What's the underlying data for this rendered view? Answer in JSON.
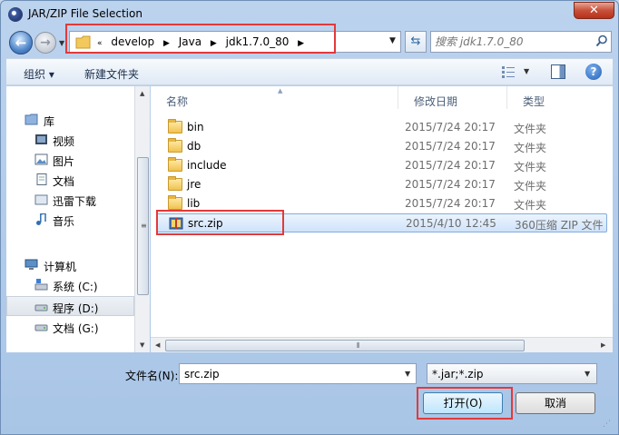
{
  "window": {
    "title": "JAR/ZIP File Selection",
    "close_label": "✕"
  },
  "address": {
    "crumbs": [
      "develop",
      "Java",
      "jdk1.7.0_80"
    ],
    "overflow": "«",
    "search_placeholder": "搜索 jdk1.7.0_80"
  },
  "toolbar": {
    "organize": "组织 ▾",
    "new_folder": "新建文件夹",
    "help": "?"
  },
  "nav": {
    "favorites": "库",
    "items": [
      "视频",
      "图片",
      "文档",
      "迅雷下载",
      "音乐"
    ],
    "computer": "计算机",
    "drives": [
      "系统 (C:)",
      "程序 (D:)",
      "文档 (G:)"
    ]
  },
  "columns": {
    "name": "名称",
    "modified": "修改日期",
    "type": "类型"
  },
  "files": [
    {
      "name": "bin",
      "modified": "2015/7/24 20:17",
      "type": "文件夹",
      "icon": "folder-icon"
    },
    {
      "name": "db",
      "modified": "2015/7/24 20:17",
      "type": "文件夹",
      "icon": "folder-icon"
    },
    {
      "name": "include",
      "modified": "2015/7/24 20:17",
      "type": "文件夹",
      "icon": "folder-icon"
    },
    {
      "name": "jre",
      "modified": "2015/7/24 20:17",
      "type": "文件夹",
      "icon": "folder-icon"
    },
    {
      "name": "lib",
      "modified": "2015/7/24 20:17",
      "type": "文件夹",
      "icon": "folder-icon"
    },
    {
      "name": "src.zip",
      "modified": "2015/4/10 12:45",
      "type": "360压缩 ZIP 文件",
      "icon": "zip-icon"
    }
  ],
  "bottom": {
    "filename_label": "文件名(N):",
    "filename_value": "src.zip",
    "filetype": "*.jar;*.zip",
    "open_label": "打开(O)",
    "cancel_label": "取消"
  },
  "colors": {
    "highlight_box": "#e23a3a",
    "selection": "#cfe3fb"
  }
}
